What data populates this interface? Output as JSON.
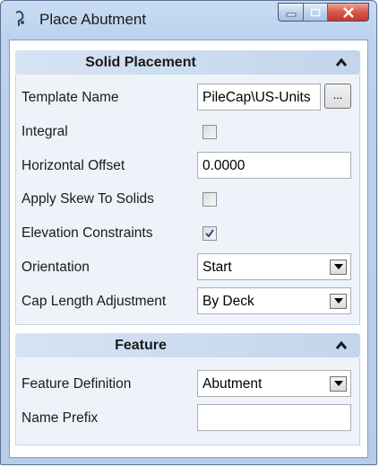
{
  "window": {
    "title": "Place Abutment",
    "minimize_icon": "minimize-icon",
    "maximize_icon": "maximize-icon",
    "close_icon": "close-icon"
  },
  "solid_placement": {
    "title": "Solid Placement",
    "template_name": {
      "label": "Template Name",
      "value": "PileCap\\US-Units",
      "browse_label": "..."
    },
    "integral": {
      "label": "Integral",
      "checked": false
    },
    "horizontal_offset": {
      "label": "Horizontal Offset",
      "value": "0.0000"
    },
    "apply_skew": {
      "label": "Apply Skew To Solids",
      "checked": false
    },
    "elevation_constraints": {
      "label": "Elevation Constraints",
      "checked": true
    },
    "orientation": {
      "label": "Orientation",
      "value": "Start"
    },
    "cap_length_adjustment": {
      "label": "Cap Length Adjustment",
      "value": "By Deck"
    }
  },
  "feature": {
    "title": "Feature",
    "feature_definition": {
      "label": "Feature Definition",
      "value": "Abutment"
    },
    "name_prefix": {
      "label": "Name Prefix",
      "value": ""
    }
  },
  "colors": {
    "frame": "#b6cde9",
    "section_header": "#c3d5ec",
    "section_body": "#eef3fa",
    "close_button": "#c5372b"
  }
}
